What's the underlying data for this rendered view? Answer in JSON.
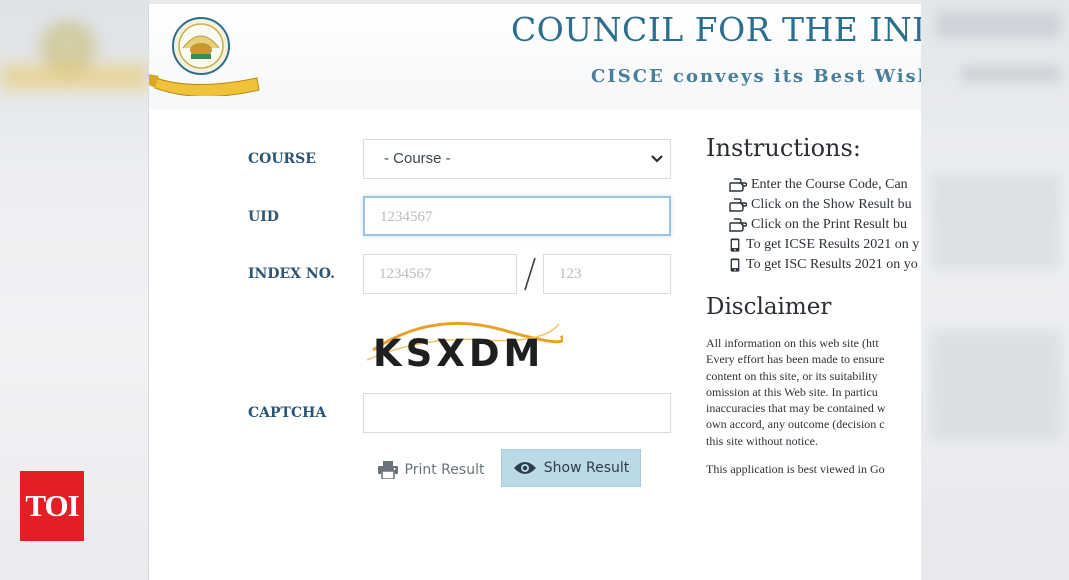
{
  "header": {
    "title": "COUNCIL FOR THE INDIA",
    "subtitle": "CISCE conveys its Best Wishes"
  },
  "form": {
    "course_label": "COURSE",
    "course_value": "- Course -",
    "uid_label": "UID",
    "uid_placeholder": "1234567",
    "index_label": "INDEX NO.",
    "index_placeholder_1": "1234567",
    "index_placeholder_2": "123",
    "captcha_label": "CAPTCHA",
    "captcha_text": "KSXDM"
  },
  "buttons": {
    "print_label": "Print Result",
    "show_label": "Show Result"
  },
  "instructions": {
    "title": "Instructions:",
    "items": [
      {
        "icon": "hand-pointer-icon",
        "text": "Enter the Course Code, Can"
      },
      {
        "icon": "hand-pointer-icon",
        "text": "Click on the Show Result bu"
      },
      {
        "icon": "hand-pointer-icon",
        "text": "Click on the Print Result bu"
      },
      {
        "icon": "mobile-icon",
        "text": "To get ICSE Results 2021 on y"
      },
      {
        "icon": "mobile-icon",
        "text": "To get ISC Results 2021 on yo"
      }
    ]
  },
  "disclaimer": {
    "title": "Disclaimer",
    "lines": [
      "All information on this web site (htt",
      "Every effort has been made to ensure",
      "content on this site, or its suitability",
      "omission at this Web site. In particu",
      "inaccuracies that may be contained w",
      "own accord, any outcome (decision c",
      "this site without notice."
    ],
    "best_view": "This application is best viewed in Go"
  },
  "badge": {
    "text": "TOI",
    "color": "#e31e24"
  },
  "colors": {
    "accent": "#2c6e8e",
    "button_bg": "#bcd9e6"
  }
}
